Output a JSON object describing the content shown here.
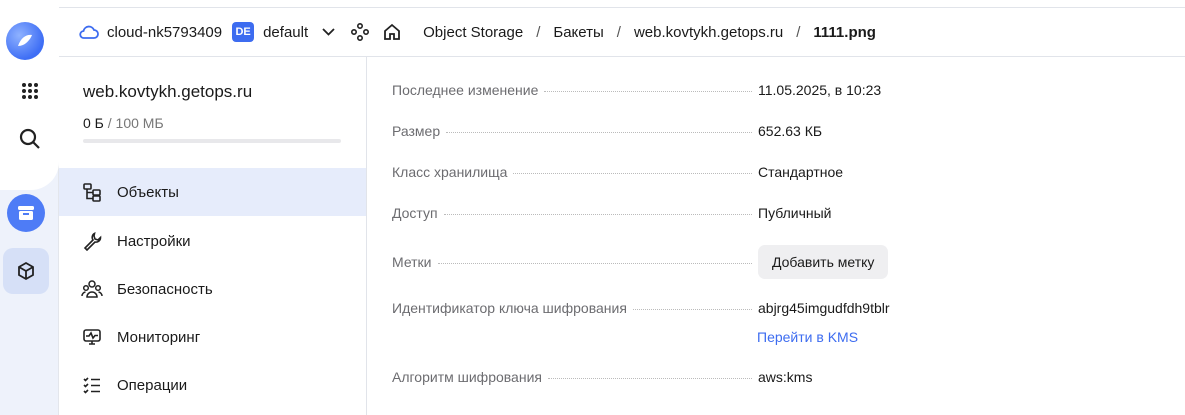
{
  "topbar": {
    "cloud": "cloud-nk5793409",
    "folder_badge": "DE",
    "folder": "default",
    "breadcrumbs": [
      "Object Storage",
      "Бакеты",
      "web.kovtykh.getops.ru"
    ],
    "current": "1111.png",
    "separator": "/"
  },
  "rail": {
    "icons": [
      "logo-icon",
      "apps-grid-icon",
      "search-icon",
      "object-storage-icon",
      "package-icon"
    ]
  },
  "sidebar": {
    "bucket": "web.kovtykh.getops.ru",
    "quota_used": "0 Б",
    "quota_max": " / 100 МБ",
    "quota_fraction": 0.0,
    "items": [
      {
        "label": "Объекты",
        "icon": "objects-icon",
        "active": true
      },
      {
        "label": "Настройки",
        "icon": "wrench-icon",
        "active": false
      },
      {
        "label": "Безопасность",
        "icon": "users-icon",
        "active": false
      },
      {
        "label": "Мониторинг",
        "icon": "monitor-icon",
        "active": false
      },
      {
        "label": "Операции",
        "icon": "list-icon",
        "active": false
      }
    ]
  },
  "details": {
    "modified_label": "Последнее изменение",
    "modified_value": "11.05.2025, в 10:23",
    "size_label": "Размер",
    "size_value": "652.63 КБ",
    "class_label": "Класс хранилища",
    "class_value": "Стандартное",
    "access_label": "Доступ",
    "access_value": "Публичный",
    "tags_label": "Метки",
    "add_tag_button": "Добавить метку",
    "key_label": "Идентификатор ключа шифрования",
    "key_value": "abjrg45imgudfdh9tblr",
    "kms_link": "Перейти в KMS",
    "algo_label": "Алгоритм шифрования",
    "algo_value": "aws:kms"
  },
  "colors": {
    "accent": "#3d6cf0",
    "active_bg": "#e6ecfb",
    "rail_bg": "#eef2fb"
  }
}
